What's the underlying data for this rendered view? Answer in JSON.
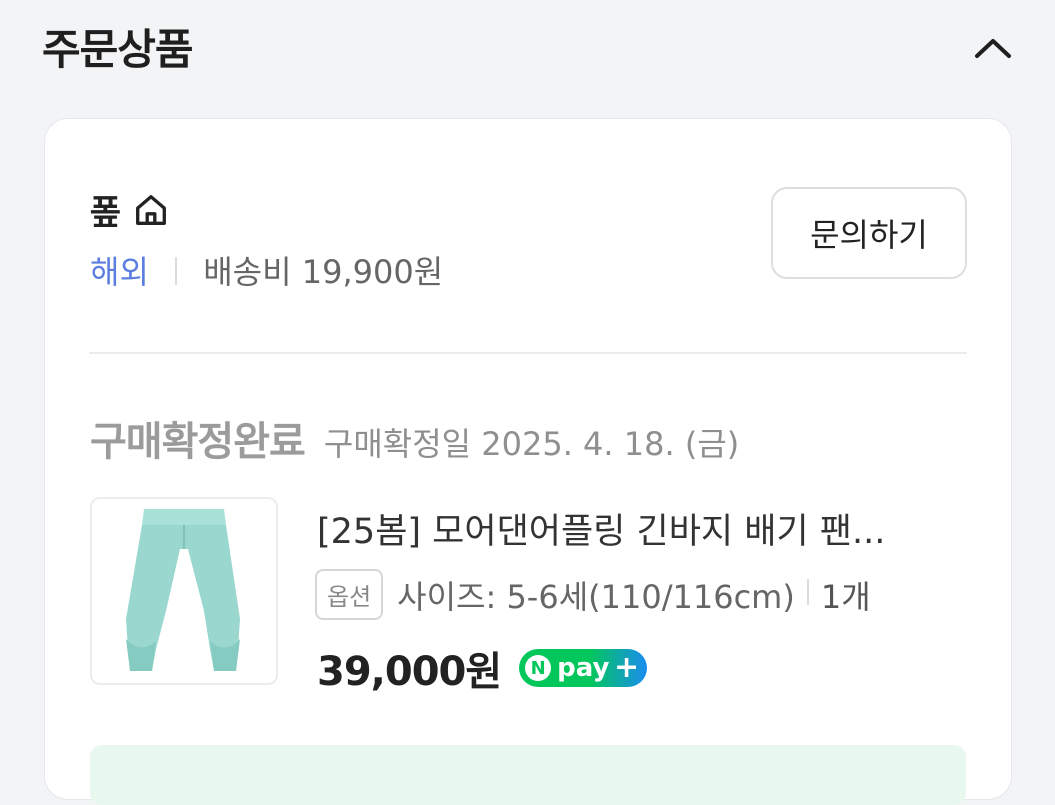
{
  "section": {
    "title": "주문상품",
    "collapse_icon": "chevron-up-icon"
  },
  "seller": {
    "name": "퐆",
    "home_icon": "home-icon",
    "origin": "해외",
    "shipping": "배송비 19,900원",
    "inquiry_label": "문의하기"
  },
  "order": {
    "status": "구매확정완료",
    "confirm_date": "구매확정일 2025. 4. 18. (금)"
  },
  "product": {
    "image_icon": "mint-pants-image",
    "name": "[25봄] 모어댄어플링 긴바지 배기 팬...",
    "option_badge": "옵션",
    "option": "사이즈: 5-6세(110/116cm)",
    "quantity": "1개",
    "price": "39,000원",
    "pay_badge": {
      "n": "N",
      "text": "pay",
      "plus": "+"
    }
  },
  "colors": {
    "accent_blue": "#5b7de0",
    "naver_green": "#03c75a"
  }
}
